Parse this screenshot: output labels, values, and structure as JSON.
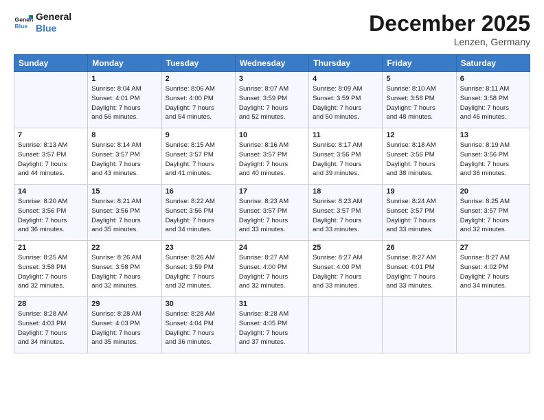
{
  "header": {
    "logo_line1": "General",
    "logo_line2": "Blue",
    "month": "December 2025",
    "location": "Lenzen, Germany"
  },
  "weekdays": [
    "Sunday",
    "Monday",
    "Tuesday",
    "Wednesday",
    "Thursday",
    "Friday",
    "Saturday"
  ],
  "weeks": [
    [
      {
        "day": "",
        "content": ""
      },
      {
        "day": "1",
        "content": "Sunrise: 8:04 AM\nSunset: 4:01 PM\nDaylight: 7 hours\nand 56 minutes."
      },
      {
        "day": "2",
        "content": "Sunrise: 8:06 AM\nSunset: 4:00 PM\nDaylight: 7 hours\nand 54 minutes."
      },
      {
        "day": "3",
        "content": "Sunrise: 8:07 AM\nSunset: 3:59 PM\nDaylight: 7 hours\nand 52 minutes."
      },
      {
        "day": "4",
        "content": "Sunrise: 8:09 AM\nSunset: 3:59 PM\nDaylight: 7 hours\nand 50 minutes."
      },
      {
        "day": "5",
        "content": "Sunrise: 8:10 AM\nSunset: 3:58 PM\nDaylight: 7 hours\nand 48 minutes."
      },
      {
        "day": "6",
        "content": "Sunrise: 8:11 AM\nSunset: 3:58 PM\nDaylight: 7 hours\nand 46 minutes."
      }
    ],
    [
      {
        "day": "7",
        "content": "Sunrise: 8:13 AM\nSunset: 3:57 PM\nDaylight: 7 hours\nand 44 minutes."
      },
      {
        "day": "8",
        "content": "Sunrise: 8:14 AM\nSunset: 3:57 PM\nDaylight: 7 hours\nand 43 minutes."
      },
      {
        "day": "9",
        "content": "Sunrise: 8:15 AM\nSunset: 3:57 PM\nDaylight: 7 hours\nand 41 minutes."
      },
      {
        "day": "10",
        "content": "Sunrise: 8:16 AM\nSunset: 3:57 PM\nDaylight: 7 hours\nand 40 minutes."
      },
      {
        "day": "11",
        "content": "Sunrise: 8:17 AM\nSunset: 3:56 PM\nDaylight: 7 hours\nand 39 minutes."
      },
      {
        "day": "12",
        "content": "Sunrise: 8:18 AM\nSunset: 3:56 PM\nDaylight: 7 hours\nand 38 minutes."
      },
      {
        "day": "13",
        "content": "Sunrise: 8:19 AM\nSunset: 3:56 PM\nDaylight: 7 hours\nand 36 minutes."
      }
    ],
    [
      {
        "day": "14",
        "content": "Sunrise: 8:20 AM\nSunset: 3:56 PM\nDaylight: 7 hours\nand 36 minutes."
      },
      {
        "day": "15",
        "content": "Sunrise: 8:21 AM\nSunset: 3:56 PM\nDaylight: 7 hours\nand 35 minutes."
      },
      {
        "day": "16",
        "content": "Sunrise: 8:22 AM\nSunset: 3:56 PM\nDaylight: 7 hours\nand 34 minutes."
      },
      {
        "day": "17",
        "content": "Sunrise: 8:23 AM\nSunset: 3:57 PM\nDaylight: 7 hours\nand 33 minutes."
      },
      {
        "day": "18",
        "content": "Sunrise: 8:23 AM\nSunset: 3:57 PM\nDaylight: 7 hours\nand 33 minutes."
      },
      {
        "day": "19",
        "content": "Sunrise: 8:24 AM\nSunset: 3:57 PM\nDaylight: 7 hours\nand 33 minutes."
      },
      {
        "day": "20",
        "content": "Sunrise: 8:25 AM\nSunset: 3:57 PM\nDaylight: 7 hours\nand 32 minutes."
      }
    ],
    [
      {
        "day": "21",
        "content": "Sunrise: 8:25 AM\nSunset: 3:58 PM\nDaylight: 7 hours\nand 32 minutes."
      },
      {
        "day": "22",
        "content": "Sunrise: 8:26 AM\nSunset: 3:58 PM\nDaylight: 7 hours\nand 32 minutes."
      },
      {
        "day": "23",
        "content": "Sunrise: 8:26 AM\nSunset: 3:59 PM\nDaylight: 7 hours\nand 32 minutes."
      },
      {
        "day": "24",
        "content": "Sunrise: 8:27 AM\nSunset: 4:00 PM\nDaylight: 7 hours\nand 32 minutes."
      },
      {
        "day": "25",
        "content": "Sunrise: 8:27 AM\nSunset: 4:00 PM\nDaylight: 7 hours\nand 33 minutes."
      },
      {
        "day": "26",
        "content": "Sunrise: 8:27 AM\nSunset: 4:01 PM\nDaylight: 7 hours\nand 33 minutes."
      },
      {
        "day": "27",
        "content": "Sunrise: 8:27 AM\nSunset: 4:02 PM\nDaylight: 7 hours\nand 34 minutes."
      }
    ],
    [
      {
        "day": "28",
        "content": "Sunrise: 8:28 AM\nSunset: 4:03 PM\nDaylight: 7 hours\nand 34 minutes."
      },
      {
        "day": "29",
        "content": "Sunrise: 8:28 AM\nSunset: 4:03 PM\nDaylight: 7 hours\nand 35 minutes."
      },
      {
        "day": "30",
        "content": "Sunrise: 8:28 AM\nSunset: 4:04 PM\nDaylight: 7 hours\nand 36 minutes."
      },
      {
        "day": "31",
        "content": "Sunrise: 8:28 AM\nSunset: 4:05 PM\nDaylight: 7 hours\nand 37 minutes."
      },
      {
        "day": "",
        "content": ""
      },
      {
        "day": "",
        "content": ""
      },
      {
        "day": "",
        "content": ""
      }
    ]
  ]
}
